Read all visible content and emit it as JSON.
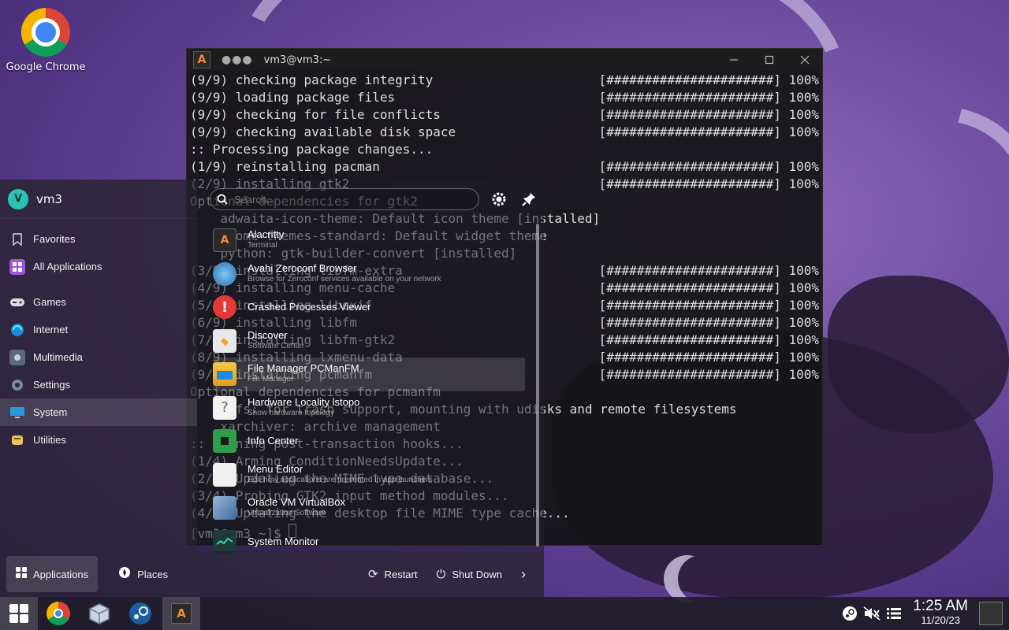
{
  "desktop": {
    "icon_label": "Google Chrome"
  },
  "terminal": {
    "title": "vm3@vm3:~",
    "lines": [
      {
        "text": "(9/9) checking package integrity",
        "bar": "[######################] 100%"
      },
      {
        "text": "(9/9) loading package files",
        "bar": "[######################] 100%"
      },
      {
        "text": "(9/9) checking for file conflicts",
        "bar": "[######################] 100%"
      },
      {
        "text": "(9/9) checking available disk space",
        "bar": "[######################] 100%"
      },
      {
        "text": ":: Processing package changes...",
        "bar": ""
      },
      {
        "text": "(1/9) reinstalling pacman",
        "bar": "[######################] 100%"
      },
      {
        "text": "(2/9) installing gtk2",
        "bar": "[######################] 100%"
      },
      {
        "text": "Optional dependencies for gtk2",
        "bar": ""
      },
      {
        "text": "    adwaita-icon-theme: Default icon theme [installed]",
        "bar": ""
      },
      {
        "text": "    gnome-themes-standard: Default widget theme",
        "bar": ""
      },
      {
        "text": "    python: gtk-builder-convert [installed]",
        "bar": ""
      },
      {
        "text": "(3/9) installing libfm-extra",
        "bar": "[######################] 100%"
      },
      {
        "text": "(4/9) installing menu-cache",
        "bar": "[######################] 100%"
      },
      {
        "text": "(5/9) installing libexif",
        "bar": "[######################] 100%"
      },
      {
        "text": "(6/9) installing libfm",
        "bar": "[######################] 100%"
      },
      {
        "text": "(7/9) installing libfm-gtk2",
        "bar": "[######################] 100%"
      },
      {
        "text": "(8/9) installing lxmenu-data",
        "bar": "[######################] 100%"
      },
      {
        "text": "(9/9) installing pcmanfm",
        "bar": "[######################] 100%"
      },
      {
        "text": "Optional dependencies for pcmanfm",
        "bar": ""
      },
      {
        "text": "    gvfs: for trash support, mounting with udisks and remote filesystems",
        "bar": ""
      },
      {
        "text": "    xarchiver: archive management",
        "bar": ""
      },
      {
        "text": ":: Running post-transaction hooks...",
        "bar": ""
      },
      {
        "text": "(1/4) Arming ConditionNeedsUpdate...",
        "bar": ""
      },
      {
        "text": "(2/4) Updating the MIME type database...",
        "bar": ""
      },
      {
        "text": "(3/4) Probing GTK2 input method modules...",
        "bar": ""
      },
      {
        "text": "(4/4) Updating the desktop file MIME type cache...",
        "bar": ""
      },
      {
        "text": "[vm3@vm3 ~]$ ",
        "bar": ""
      }
    ]
  },
  "menu": {
    "user_initial": "V",
    "user_name": "vm3",
    "categories": [
      {
        "label": "Favorites",
        "icon": "bookmark-icon"
      },
      {
        "label": "All Applications",
        "icon": "grid-icon"
      },
      {
        "label": "Games",
        "icon": "gamepad-icon"
      },
      {
        "label": "Internet",
        "icon": "globe-icon"
      },
      {
        "label": "Multimedia",
        "icon": "media-icon"
      },
      {
        "label": "Settings",
        "icon": "gear-icon"
      },
      {
        "label": "System",
        "icon": "monitor-icon"
      },
      {
        "label": "Utilities",
        "icon": "tools-icon"
      }
    ],
    "active_category": "System",
    "search_placeholder": "Search...",
    "apps": [
      {
        "name": "Alacritty",
        "desc": "Terminal"
      },
      {
        "name": "Avahi Zeroconf Browser",
        "desc": "Browse for Zeroconf services available on your network"
      },
      {
        "name": "Crashed Processes Viewer",
        "desc": ""
      },
      {
        "name": "Discover",
        "desc": "Software Center"
      },
      {
        "name": "File Manager PCManFM",
        "desc": "File Manager"
      },
      {
        "name": "Hardware Locality lstopo",
        "desc": "Show hardware topology"
      },
      {
        "name": "Info Center",
        "desc": ""
      },
      {
        "name": "Menu Editor",
        "desc": "Edit how applications are presented in app launchers"
      },
      {
        "name": "Oracle VM VirtualBox",
        "desc": "Virtualization Software"
      },
      {
        "name": "System Monitor",
        "desc": ""
      }
    ],
    "bottom": {
      "applications": "Applications",
      "places": "Places",
      "restart": "Restart",
      "shutdown": "Shut Down"
    }
  },
  "taskbar": {
    "time": "1:25 AM",
    "date": "11/20/23"
  },
  "colors": {
    "accent": "#2bc4b4",
    "terminal_bg": "#141416",
    "panel_bg": "#26222e"
  }
}
